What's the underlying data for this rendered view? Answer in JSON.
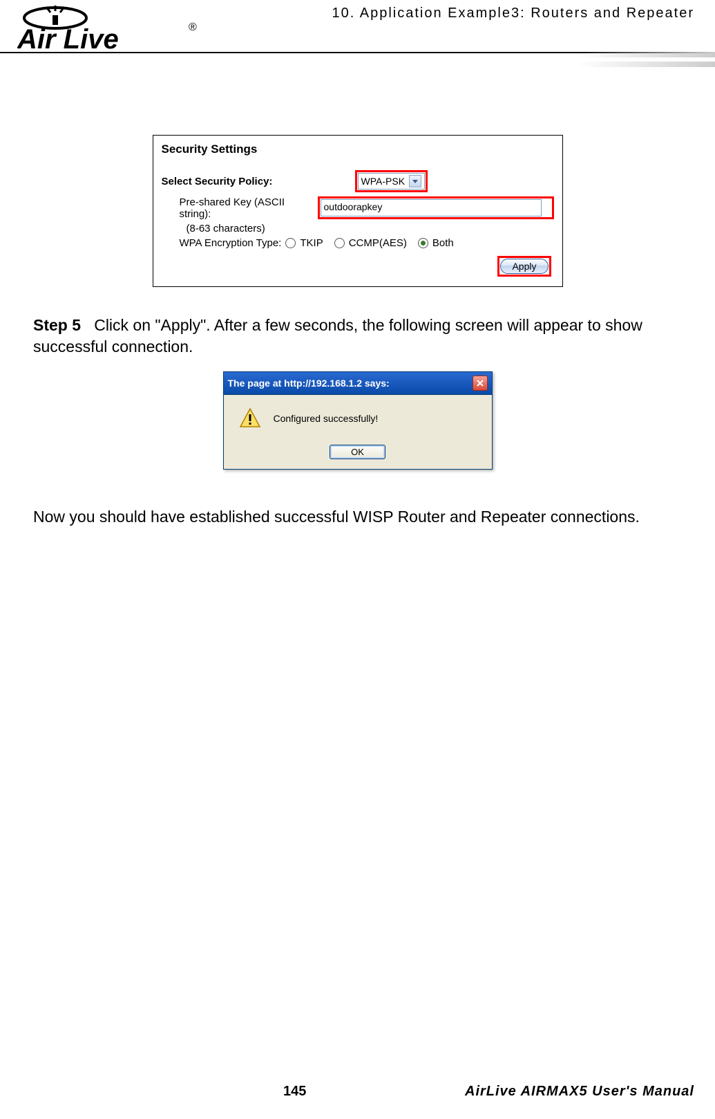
{
  "header": {
    "chapter": "10. Application Example3: Routers and Repeater",
    "logo_text": "Air Live",
    "logo_r": "®"
  },
  "screenshot1": {
    "title": "Security Settings",
    "select_policy_label": "Select Security Policy:",
    "select_policy_value": "WPA-PSK",
    "psk_label": "Pre-shared Key (ASCII string):",
    "psk_value": "outdoorapkey",
    "psk_hint": "(8-63 characters)",
    "enc_label": "WPA Encryption Type:",
    "enc_opt_tkip": "TKIP",
    "enc_opt_ccmp": "CCMP(AES)",
    "enc_opt_both": "Both",
    "apply_label": "Apply"
  },
  "step5": {
    "label": "Step 5",
    "text": "Click on \"Apply\".    After a few seconds, the following screen will appear to show successful connection."
  },
  "screenshot2": {
    "title": "The page at http://192.168.1.2 says:",
    "message": "Configured successfully!",
    "ok_label": "OK"
  },
  "conclusion": "Now you should have established successful WISP Router and Repeater connections.",
  "footer": {
    "page_number": "145",
    "doc_title": "AirLive AIRMAX5 User's Manual"
  }
}
